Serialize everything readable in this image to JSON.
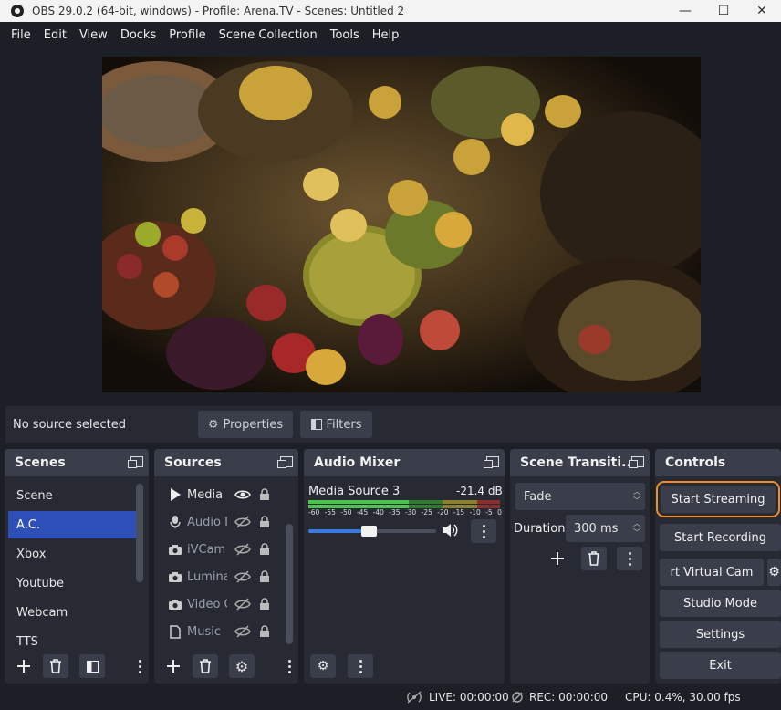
{
  "window": {
    "title": "OBS 29.0.2 (64-bit, windows) - Profile: Arena.TV - Scenes: Untitled 2",
    "minimize": "—",
    "maximize": "☐",
    "close": "✕"
  },
  "menu": [
    "File",
    "Edit",
    "View",
    "Docks",
    "Profile",
    "Scene Collection",
    "Tools",
    "Help"
  ],
  "source_bar": {
    "status": "No source selected",
    "properties_label": "Properties",
    "filters_label": "Filters"
  },
  "scenes": {
    "title": "Scenes",
    "items": [
      "Scene",
      "A.C.",
      "Xbox",
      "Youtube",
      "Webcam",
      "TTS"
    ],
    "selected_index": 1
  },
  "sources": {
    "title": "Sources",
    "items": [
      {
        "name": "Media S",
        "icon": "play-icon",
        "visible": true
      },
      {
        "name": "Audio I",
        "icon": "microphone-icon",
        "visible": false
      },
      {
        "name": "iVCam",
        "icon": "camera-icon",
        "visible": false
      },
      {
        "name": "Lumina",
        "icon": "camera-icon",
        "visible": false
      },
      {
        "name": "Video C",
        "icon": "camera-icon",
        "visible": false
      },
      {
        "name": "Music",
        "icon": "file-icon",
        "visible": false
      }
    ]
  },
  "audio_mixer": {
    "title": "Audio Mixer",
    "channel_name": "Media Source 3",
    "level": "-21.4 dB",
    "scale": [
      "-60",
      "-55",
      "-50",
      "-45",
      "-40",
      "-35",
      "-30",
      "-25",
      "-20",
      "-15",
      "-10",
      "-5",
      "0"
    ],
    "volume_fraction": 0.47
  },
  "scene_transitions": {
    "title": "Scene Transiti...",
    "transition": "Fade",
    "duration_label": "Duration",
    "duration_value": "300 ms"
  },
  "controls": {
    "title": "Controls",
    "start_streaming": "Start Streaming",
    "start_recording": "Start Recording",
    "virtual_cam": "rt Virtual Cam",
    "studio_mode": "Studio Mode",
    "settings": "Settings",
    "exit": "Exit"
  },
  "status": {
    "live": "LIVE: 00:00:00",
    "rec": "REC: 00:00:00",
    "cpu": "CPU: 0.4%, 30.00 fps"
  },
  "colors": {
    "accent_selected": "#2e4fb8",
    "highlight_outline": "#f08c2b",
    "meter_green": "#4cc34c",
    "meter_yellow": "#d7c93b",
    "meter_red": "#c84040"
  }
}
